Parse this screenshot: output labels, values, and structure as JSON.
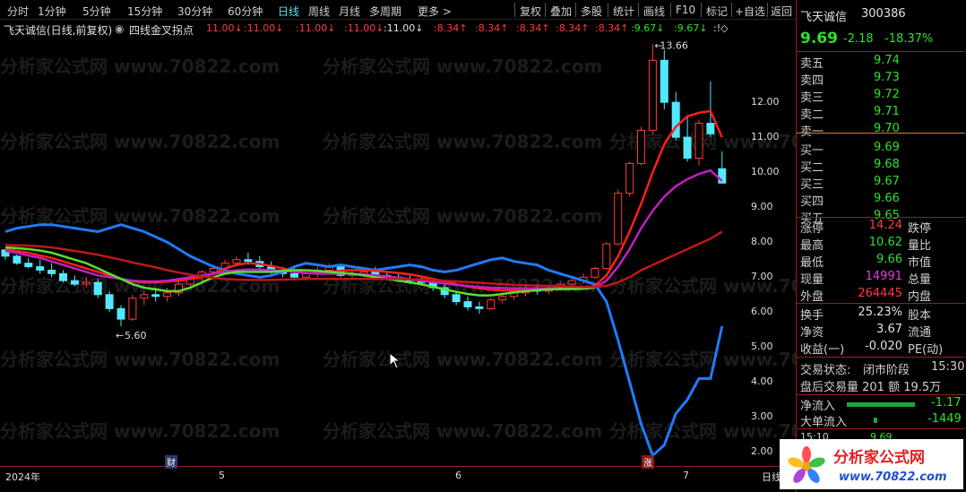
{
  "periods": [
    {
      "label": "分时"
    },
    {
      "label": "1分钟"
    },
    {
      "label": "5分钟"
    },
    {
      "label": "15分钟"
    },
    {
      "label": "30分钟"
    },
    {
      "label": "60分钟"
    },
    {
      "label": "日线",
      "active": true
    },
    {
      "label": "周线"
    },
    {
      "label": "月线"
    },
    {
      "label": "多周期"
    },
    {
      "label": "更多 >"
    }
  ],
  "tools": [
    "复权",
    "叠加",
    "多股",
    "统计",
    "画线",
    "F10",
    "标记",
    "+自选",
    "返回"
  ],
  "title": {
    "stock": "飞天诚信(日线,前复权)",
    "indicator": "四线金叉拐点"
  },
  "indicator_marks": [
    {
      "text": "11.00↓",
      "color": "r"
    },
    {
      "text": ":11.00↓",
      "color": "r"
    },
    {
      "text": ":11.00↓",
      "color": "r"
    },
    {
      "text": ":11.00↓",
      "color": "r"
    },
    {
      "text": ":11.00↓",
      "color": "w"
    },
    {
      "text": ":8.34↑",
      "color": "r"
    },
    {
      "text": ":8.34↑",
      "color": "r"
    },
    {
      "text": ":8.34↑",
      "color": "r"
    },
    {
      "text": ":8.34↑",
      "color": "r"
    },
    {
      "text": ":8.34↑",
      "color": "r"
    },
    {
      "text": ":9.67↓",
      "color": "g"
    },
    {
      "text": ":9.67↓",
      "color": "g"
    },
    {
      "text": ":!◇",
      "color": "w"
    }
  ],
  "chart_data": {
    "type": "line",
    "title": "四线金叉拐点",
    "y_ticks": [
      "12.00",
      "11.00",
      "10.00",
      "9.00",
      "8.00",
      "7.00",
      "6.00",
      "5.00",
      "4.00",
      "3.00",
      "2.00"
    ],
    "x_ticks": [
      "2024年",
      "5",
      "6",
      "7",
      "日线"
    ],
    "annotations": [
      "13.66",
      "5.60"
    ],
    "ylim": [
      1.6,
      13.9
    ],
    "badges": [
      "财",
      "涨"
    ],
    "colors": {
      "up": "#ff3b3b",
      "down": "#54e8ff",
      "blue": "#1f7bff",
      "red": "#ff1f1f",
      "magenta": "#c020c0",
      "green": "#58e030",
      "darkred": "#c01818"
    },
    "candles": [
      [
        7.78,
        7.8,
        7.5,
        7.6
      ],
      [
        7.6,
        7.65,
        7.35,
        7.4
      ],
      [
        7.4,
        7.55,
        7.25,
        7.3
      ],
      [
        7.3,
        7.5,
        7.1,
        7.2
      ],
      [
        7.2,
        7.4,
        7.0,
        7.1
      ],
      [
        7.1,
        7.2,
        6.85,
        6.9
      ],
      [
        6.9,
        7.05,
        6.75,
        6.8
      ],
      [
        6.8,
        7.0,
        6.7,
        6.85
      ],
      [
        6.85,
        6.95,
        6.4,
        6.5
      ],
      [
        6.5,
        6.6,
        6.0,
        6.1
      ],
      [
        6.1,
        6.2,
        5.6,
        5.8
      ],
      [
        5.8,
        6.5,
        5.75,
        6.4
      ],
      [
        6.4,
        6.6,
        6.2,
        6.5
      ],
      [
        6.5,
        6.7,
        6.3,
        6.45
      ],
      [
        6.45,
        6.7,
        6.3,
        6.55
      ],
      [
        6.55,
        6.9,
        6.45,
        6.8
      ],
      [
        6.8,
        7.1,
        6.7,
        7.0
      ],
      [
        7.0,
        7.2,
        6.9,
        7.15
      ],
      [
        7.15,
        7.35,
        7.05,
        7.25
      ],
      [
        7.25,
        7.5,
        7.15,
        7.4
      ],
      [
        7.4,
        7.6,
        7.3,
        7.5
      ],
      [
        7.5,
        7.7,
        7.35,
        7.45
      ],
      [
        7.45,
        7.6,
        7.2,
        7.3
      ],
      [
        7.3,
        7.45,
        7.1,
        7.2
      ],
      [
        7.2,
        7.3,
        7.0,
        7.1
      ],
      [
        7.1,
        7.25,
        6.95,
        7.0
      ],
      [
        7.0,
        7.2,
        6.9,
        7.1
      ],
      [
        7.1,
        7.3,
        7.0,
        7.2
      ],
      [
        7.2,
        7.4,
        7.1,
        7.3
      ],
      [
        7.3,
        7.35,
        7.0,
        7.05
      ],
      [
        7.05,
        7.2,
        6.95,
        7.1
      ],
      [
        7.1,
        7.25,
        7.0,
        7.15
      ],
      [
        7.15,
        7.3,
        7.0,
        7.05
      ],
      [
        7.05,
        7.15,
        6.9,
        7.0
      ],
      [
        7.0,
        7.1,
        6.85,
        6.95
      ],
      [
        6.95,
        7.05,
        6.8,
        6.9
      ],
      [
        6.9,
        7.0,
        6.75,
        6.85
      ],
      [
        6.85,
        6.95,
        6.6,
        6.7
      ],
      [
        6.7,
        6.8,
        6.4,
        6.5
      ],
      [
        6.5,
        6.6,
        6.2,
        6.3
      ],
      [
        6.3,
        6.45,
        6.05,
        6.15
      ],
      [
        6.15,
        6.3,
        5.95,
        6.1
      ],
      [
        6.1,
        6.4,
        6.05,
        6.35
      ],
      [
        6.35,
        6.55,
        6.25,
        6.45
      ],
      [
        6.45,
        6.65,
        6.35,
        6.55
      ],
      [
        6.55,
        6.75,
        6.45,
        6.65
      ],
      [
        6.65,
        6.8,
        6.5,
        6.6
      ],
      [
        6.6,
        6.75,
        6.5,
        6.7
      ],
      [
        6.7,
        6.9,
        6.6,
        6.8
      ],
      [
        6.8,
        7.0,
        6.7,
        6.9
      ],
      [
        6.9,
        7.1,
        6.8,
        7.0
      ],
      [
        7.0,
        7.3,
        6.95,
        7.25
      ],
      [
        7.25,
        8.0,
        7.2,
        7.95
      ],
      [
        7.95,
        9.5,
        7.9,
        9.4
      ],
      [
        9.4,
        10.3,
        9.3,
        10.25
      ],
      [
        10.25,
        11.3,
        10.2,
        11.2
      ],
      [
        11.2,
        13.66,
        11.1,
        13.2
      ],
      [
        13.2,
        13.5,
        11.8,
        12.0
      ],
      [
        12.0,
        12.3,
        10.9,
        11.0
      ],
      [
        11.0,
        11.6,
        10.3,
        10.4
      ],
      [
        10.4,
        11.5,
        10.2,
        11.4
      ],
      [
        11.4,
        12.6,
        11.0,
        11.1
      ],
      [
        10.1,
        10.6,
        9.7,
        9.69
      ]
    ],
    "series": [
      {
        "color": "blue",
        "values": [
          8.3,
          8.4,
          8.45,
          8.5,
          8.5,
          8.45,
          8.4,
          8.35,
          8.3,
          8.4,
          8.5,
          8.4,
          8.3,
          8.15,
          8.0,
          7.8,
          7.6,
          7.45,
          7.3,
          7.2,
          7.1,
          7.05,
          7.0,
          7.05,
          7.15,
          7.3,
          7.4,
          7.35,
          7.3,
          7.35,
          7.3,
          7.25,
          7.2,
          7.25,
          7.3,
          7.35,
          7.3,
          7.2,
          7.15,
          7.2,
          7.3,
          7.4,
          7.5,
          7.55,
          7.45,
          7.4,
          7.35,
          7.2,
          7.1,
          7.0,
          6.9,
          6.8,
          6.3,
          5.2,
          4.0,
          2.8,
          1.9,
          2.2,
          3.1,
          3.5,
          4.1,
          4.1,
          5.6
        ]
      },
      {
        "color": "red",
        "values": [
          7.8,
          7.75,
          7.7,
          7.62,
          7.55,
          7.45,
          7.35,
          7.25,
          7.15,
          7.05,
          6.95,
          6.88,
          6.85,
          6.85,
          6.87,
          6.9,
          6.95,
          7.0,
          7.1,
          7.25,
          7.35,
          7.4,
          7.38,
          7.32,
          7.25,
          7.18,
          7.12,
          7.12,
          7.15,
          7.18,
          7.2,
          7.2,
          7.18,
          7.15,
          7.12,
          7.08,
          7.02,
          6.95,
          6.88,
          6.8,
          6.73,
          6.68,
          6.64,
          6.62,
          6.62,
          6.63,
          6.64,
          6.65,
          6.66,
          6.67,
          6.68,
          6.75,
          7.05,
          7.6,
          8.3,
          9.1,
          10.0,
          10.8,
          11.3,
          11.6,
          11.7,
          11.75,
          11.0
        ]
      },
      {
        "color": "magenta",
        "values": [
          7.75,
          7.7,
          7.62,
          7.55,
          7.45,
          7.35,
          7.25,
          7.15,
          7.05,
          7.0,
          6.95,
          6.9,
          6.88,
          6.88,
          6.9,
          6.95,
          7.0,
          7.05,
          7.1,
          7.15,
          7.2,
          7.22,
          7.22,
          7.2,
          7.18,
          7.15,
          7.12,
          7.1,
          7.1,
          7.1,
          7.1,
          7.08,
          7.05,
          7.02,
          6.98,
          6.94,
          6.9,
          6.86,
          6.82,
          6.78,
          6.75,
          6.72,
          6.7,
          6.69,
          6.68,
          6.68,
          6.68,
          6.68,
          6.68,
          6.68,
          6.68,
          6.7,
          6.9,
          7.3,
          7.8,
          8.4,
          8.9,
          9.3,
          9.6,
          9.8,
          9.95,
          10.05,
          9.75
        ]
      },
      {
        "color": "green",
        "values": [
          7.85,
          7.83,
          7.8,
          7.76,
          7.7,
          7.6,
          7.5,
          7.4,
          7.25,
          7.1,
          6.95,
          6.8,
          6.7,
          6.65,
          6.6,
          6.6,
          6.7,
          6.85,
          7.0,
          7.1,
          7.15,
          7.15,
          7.15,
          7.15,
          7.18,
          7.2,
          7.2,
          7.18,
          7.15,
          7.12,
          7.1,
          7.05,
          7.0,
          6.95,
          6.9,
          6.85,
          6.8,
          6.72,
          6.65,
          6.58,
          6.52,
          6.48,
          6.48,
          6.52,
          6.56,
          6.6,
          6.63,
          6.65,
          6.66,
          6.66,
          6.67,
          6.7
        ]
      },
      {
        "color": "darkred",
        "values": [
          7.92,
          7.91,
          7.9,
          7.88,
          7.85,
          7.8,
          7.75,
          7.7,
          7.64,
          7.57,
          7.5,
          7.42,
          7.35,
          7.28,
          7.2,
          7.13,
          7.07,
          7.02,
          6.98,
          6.95,
          6.93,
          6.92,
          6.92,
          6.92,
          6.93,
          6.94,
          6.95,
          6.95,
          6.95,
          6.95,
          6.95,
          6.95,
          6.95,
          6.95,
          6.95,
          6.94,
          6.93,
          6.92,
          6.9,
          6.88,
          6.86,
          6.84,
          6.82,
          6.8,
          6.78,
          6.77,
          6.76,
          6.75,
          6.74,
          6.73,
          6.72,
          6.72,
          6.75,
          6.85,
          7.0,
          7.2,
          7.35,
          7.5,
          7.65,
          7.8,
          7.95,
          8.1,
          8.3
        ]
      }
    ]
  },
  "side": {
    "stock_name": "飞天诚信",
    "stock_code": "300386",
    "price": "9.69",
    "change": "-2.18",
    "change_pct": "-18.37%",
    "asks": [
      {
        "label": "卖五",
        "price": "9.74"
      },
      {
        "label": "卖四",
        "price": "9.73"
      },
      {
        "label": "卖三",
        "price": "9.72"
      },
      {
        "label": "卖二",
        "price": "9.71"
      },
      {
        "label": "卖一",
        "price": "9.70"
      }
    ],
    "bids": [
      {
        "label": "买一",
        "price": "9.69"
      },
      {
        "label": "买二",
        "price": "9.68"
      },
      {
        "label": "买三",
        "price": "9.67"
      },
      {
        "label": "买四",
        "price": "9.66"
      },
      {
        "label": "买五",
        "price": "9.65"
      }
    ],
    "stats": [
      {
        "l1": "涨停",
        "v1": "14.24",
        "c1": "#ff3b3b",
        "l2": "跌停"
      },
      {
        "l1": "最高",
        "v1": "10.62",
        "c1": "#2ee02e",
        "l2": "量比"
      },
      {
        "l1": "最低",
        "v1": "9.66",
        "c1": "#2ee02e",
        "l2": "市值"
      },
      {
        "l1": "现量",
        "v1": "14991",
        "c1": "#e040e0",
        "l2": "总量"
      },
      {
        "l1": "外盘",
        "v1": "264445",
        "c1": "#ff3b3b",
        "l2": "内盘"
      }
    ],
    "fin": [
      {
        "l1": "换手",
        "v1": "25.23%",
        "l2": "股本"
      },
      {
        "l1": "净资",
        "v1": "3.67",
        "l2": "流通"
      },
      {
        "l1": "收益(一)",
        "v1": "-0.020",
        "l2": "PE(动)"
      }
    ],
    "trade_status_label": "交易状态:",
    "trade_status": "闭市阶段",
    "trade_time": "15:30:",
    "after_hours": "盘后交易量 201 额 19.5万",
    "flows": [
      {
        "label": "净流入",
        "value": "-1.17"
      },
      {
        "label": "大单流入",
        "value": "-1449"
      }
    ],
    "tick_time": "15:10",
    "tick_price": "9.69"
  },
  "watermark": "分析家公式网 www.70822.com",
  "logo": {
    "title": "分析家公式网",
    "url": "www.70822.com"
  }
}
